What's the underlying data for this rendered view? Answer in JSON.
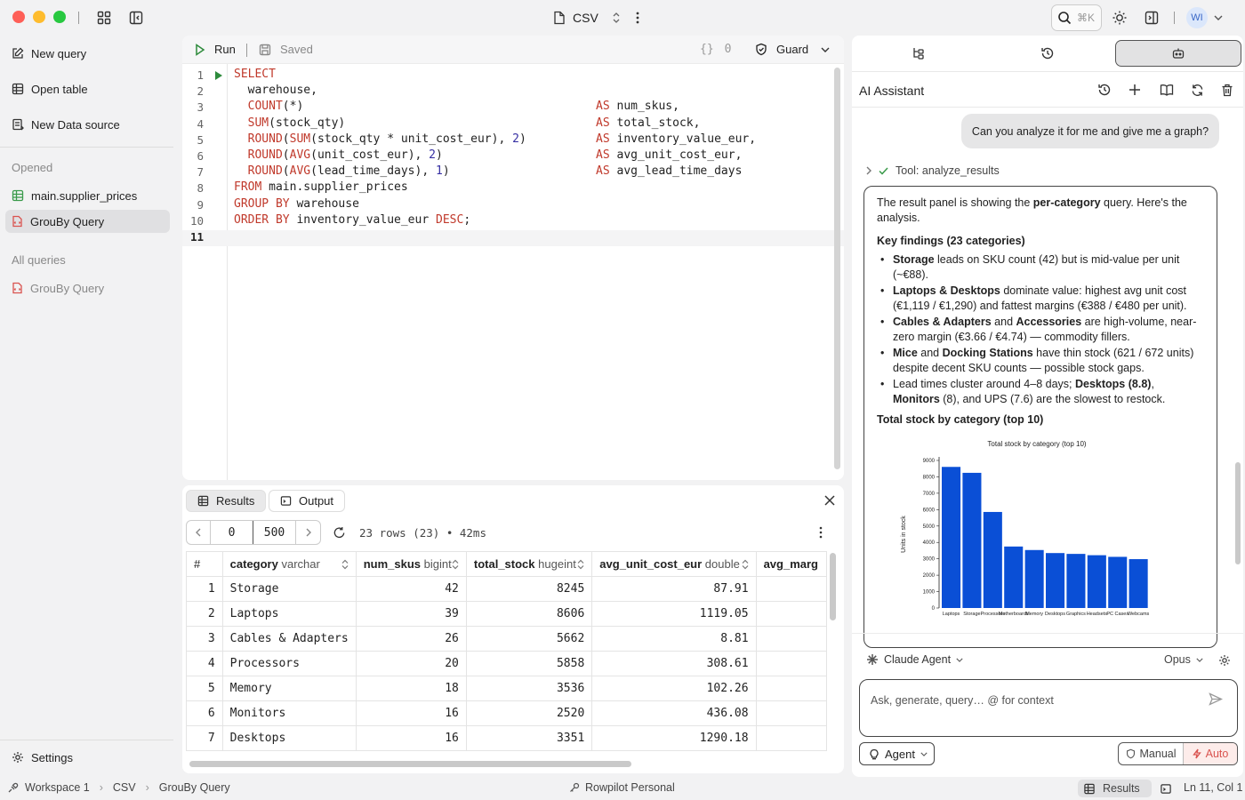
{
  "titlebar": {
    "title": "CSV",
    "shortcut": "⌘K",
    "avatar": "WI"
  },
  "sidebar": {
    "actions": [
      {
        "label": "New query",
        "icon": "edit-icon"
      },
      {
        "label": "Open table",
        "icon": "table-icon"
      },
      {
        "label": "New Data source",
        "icon": "datasource-icon"
      }
    ],
    "opened_header": "Opened",
    "opened": [
      {
        "label": "main.supplier_prices",
        "icon": "table-icon",
        "active": false
      },
      {
        "label": "GrouBy Query",
        "icon": "sql-file-icon",
        "active": true
      }
    ],
    "all_header": "All queries",
    "queries": [
      {
        "label": "GrouBy Query",
        "icon": "sql-file-icon"
      }
    ],
    "settings_label": "Settings"
  },
  "editor": {
    "run_label": "Run",
    "saved_label": "Saved",
    "param_count": "0",
    "guard_label": "Guard",
    "line_numbers": [
      "1",
      "2",
      "3",
      "4",
      "5",
      "6",
      "7",
      "8",
      "9",
      "10",
      "11"
    ],
    "lines": [
      "SELECT",
      "  warehouse,",
      "  COUNT(*)                                          AS num_skus,",
      "  SUM(stock_qty)                                    AS total_stock,",
      "  ROUND(SUM(stock_qty * unit_cost_eur), 2)          AS inventory_value_eur,",
      "  ROUND(AVG(unit_cost_eur), 2)                      AS avg_unit_cost_eur,",
      "  ROUND(AVG(lead_time_days), 1)                     AS avg_lead_time_days",
      "FROM main.supplier_prices",
      "GROUP BY warehouse",
      "ORDER BY inventory_value_eur DESC;",
      ""
    ]
  },
  "results": {
    "tab_results": "Results",
    "tab_output": "Output",
    "offset": "0",
    "limit": "500",
    "summary": "23 rows (23) • 42ms",
    "columns": [
      {
        "name": "category",
        "type": "varchar"
      },
      {
        "name": "num_skus",
        "type": "bigint"
      },
      {
        "name": "total_stock",
        "type": "hugeint"
      },
      {
        "name": "avg_unit_cost_eur",
        "type": "double"
      },
      {
        "name": "avg_marg",
        "type": ""
      }
    ],
    "rows": [
      [
        "1",
        "Storage",
        "42",
        "8245",
        "87.91"
      ],
      [
        "2",
        "Laptops",
        "39",
        "8606",
        "1119.05"
      ],
      [
        "3",
        "Cables & Adapters",
        "26",
        "5662",
        "8.81"
      ],
      [
        "4",
        "Processors",
        "20",
        "5858",
        "308.61"
      ],
      [
        "5",
        "Memory",
        "18",
        "3536",
        "102.26"
      ],
      [
        "6",
        "Monitors",
        "16",
        "2520",
        "436.08"
      ],
      [
        "7",
        "Desktops",
        "16",
        "3351",
        "1290.18"
      ]
    ]
  },
  "ai": {
    "title": "AI Assistant",
    "user_message": "Can you analyze it for me and give me a graph?",
    "tool_label": "Tool:",
    "tool_name": "analyze_results",
    "intro_a": "The result panel is showing the ",
    "intro_b": "per-category",
    "intro_c": " query. Here's the analysis.",
    "findings_title": "Key findings (23 categories)",
    "findings": [
      {
        "bold": "Storage",
        "text": " leads on SKU count (42) but is mid-value per unit (~€88)."
      },
      {
        "bold": "Laptops & Desktops",
        "text": " dominate value: highest avg unit cost (€1,119 / €1,290) and fattest margins (€388 / €480 per unit)."
      },
      {
        "bold": "Cables & Adapters",
        "text": " and ",
        "bold2": "Accessories",
        "text2": " are high-volume, near-zero margin (€3.66 / €4.74) — commodity fillers."
      },
      {
        "bold": "Mice",
        "text": " and ",
        "bold2": "Docking Stations",
        "text2": " have thin stock (621 / 672 units) despite decent SKU counts — possible stock gaps."
      },
      {
        "bold": "",
        "text": "Lead times cluster around 4–8 days; ",
        "bold2": "Desktops (8.8)",
        "text2": ", ",
        "bold3": "Monitors",
        "text3": " (8), and UPS (7.6) are the slowest to restock."
      }
    ],
    "chart_heading": "Total stock by category (top 10)",
    "agent_label": "Claude Agent",
    "model_label": "Opus",
    "input_placeholder": "Ask, generate, query… @ for context",
    "mode_label": "Agent",
    "manual_label": "Manual",
    "auto_label": "Auto"
  },
  "chart_data": {
    "type": "bar",
    "title": "Total stock by category (top 10)",
    "ylabel": "Units in stock",
    "xlabel": "",
    "categories": [
      "Laptops",
      "Storage",
      "Processors",
      "Motherboards",
      "Memory",
      "Desktops",
      "Graphics",
      "Headsets",
      "PC Cases",
      "Webcams"
    ],
    "values": [
      8606,
      8245,
      5858,
      3750,
      3536,
      3351,
      3300,
      3220,
      3120,
      2980
    ],
    "yticks": [
      0,
      1000,
      2000,
      3000,
      4000,
      5000,
      6000,
      7000,
      8000,
      9000
    ],
    "ylim": [
      0,
      9000
    ],
    "color": "#0a4fd6",
    "grid": false
  },
  "statusbar": {
    "workspace": "Workspace 1",
    "crumb2": "CSV",
    "crumb3": "GrouBy Query",
    "center": "Rowpilot Personal",
    "results_label": "Results",
    "position": "Ln 11, Col 1"
  }
}
